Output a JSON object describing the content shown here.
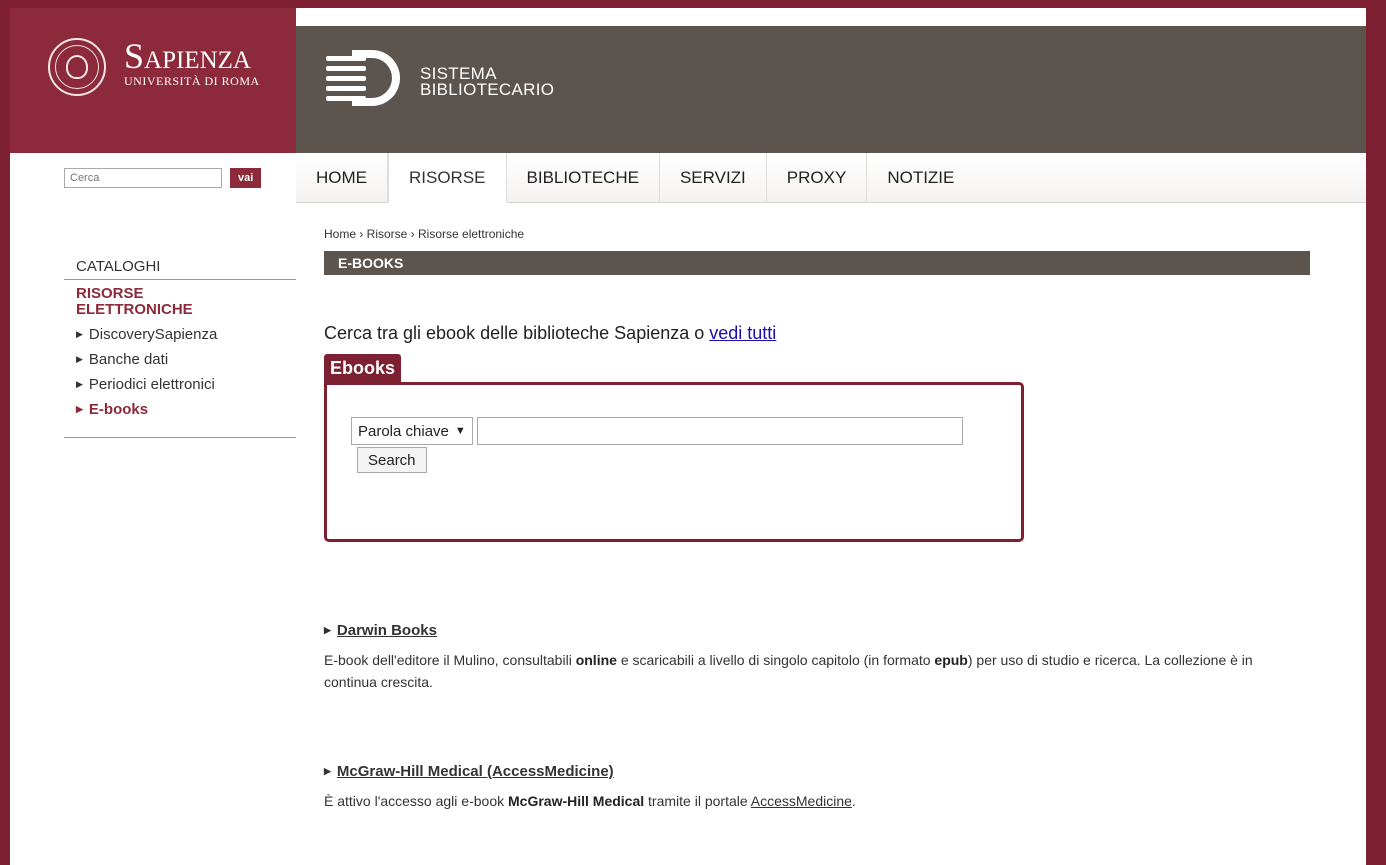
{
  "header": {
    "brand_name": "Sapienza",
    "brand_sub": "Università di Roma",
    "system_line1": "SISTEMA",
    "system_line2": "BIBLIOTECARIO"
  },
  "site_search": {
    "placeholder": "Cerca",
    "button_label": "vai"
  },
  "nav": {
    "items": [
      {
        "label": "HOME"
      },
      {
        "label": "RISORSE"
      },
      {
        "label": "BIBLIOTECHE"
      },
      {
        "label": "SERVIZI"
      },
      {
        "label": "PROXY"
      },
      {
        "label": "NOTIZIE"
      }
    ],
    "active_index": 1
  },
  "sidebar": {
    "category": "CATALOGHI",
    "section_line1": "RISORSE",
    "section_line2": "ELETTRONICHE",
    "links": [
      {
        "label": "DiscoverySapienza"
      },
      {
        "label": "Banche dati"
      },
      {
        "label": "Periodici elettronici"
      },
      {
        "label": "E-books"
      }
    ],
    "active_link": "E-books"
  },
  "main": {
    "breadcrumb": "Home › Risorse › Risorse elettroniche",
    "section_title": "E-BOOKS",
    "intro_text": "Cerca tra gli ebook delle biblioteche Sapienza o ",
    "intro_link": "vedi tutti",
    "search_box": {
      "tab_label": "Ebooks",
      "select_value": "Parola chiave",
      "query_value": "",
      "button_label": "Search"
    },
    "entries": [
      {
        "title": "Darwin Books",
        "desc_a": "E-book dell'editore il Mulino, consultabili ",
        "desc_b1": "online",
        "desc_c": " e scaricabili a livello di singolo capitolo (in formato ",
        "desc_b2": "epub",
        "desc_d": ") per uso di studio e ricerca. La collezione è in continua crescita."
      },
      {
        "title": "McGraw-Hill Medical (AccessMedicine)",
        "desc_a": "È attivo l'accesso agli e-book ",
        "desc_b1": "McGraw-Hill Medical",
        "desc_c": " tramite il portale ",
        "desc_link": "AccessMedicine",
        "desc_d": "."
      }
    ]
  },
  "colors": {
    "brand": "#7d2032",
    "header_gray": "#5b544f"
  }
}
